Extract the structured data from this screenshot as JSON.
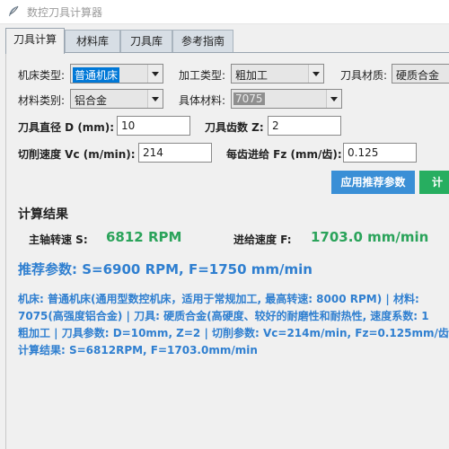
{
  "window": {
    "title": "数控刀具计算器"
  },
  "tabs": [
    {
      "label": "刀具计算",
      "active": true
    },
    {
      "label": "材料库",
      "active": false
    },
    {
      "label": "刀具库",
      "active": false
    },
    {
      "label": "参考指南",
      "active": false
    }
  ],
  "form": {
    "machine_type_label": "机床类型:",
    "machine_type_value": "普通机床",
    "process_type_label": "加工类型:",
    "process_type_value": "粗加工",
    "tool_material_label": "刀具材质:",
    "tool_material_value": "硬质合金",
    "material_category_label": "材料类别:",
    "material_category_value": "铝合金",
    "specific_material_label": "具体材料:",
    "specific_material_value": "7075",
    "tool_diameter_label": "刀具直径 D (mm):",
    "tool_diameter_value": "10",
    "teeth_label": "刀具齿数 Z:",
    "teeth_value": "2",
    "cutting_speed_label": "切削速度 Vc (m/min):",
    "cutting_speed_value": "214",
    "feed_per_tooth_label": "每齿进给 Fz (mm/齿):",
    "feed_per_tooth_value": "0.125"
  },
  "buttons": {
    "apply_recommended": "应用推荐参数",
    "calculate": "计算"
  },
  "results": {
    "heading": "计算结果",
    "spindle_label": "主轴转速 S:",
    "spindle_value": "6812 RPM",
    "feed_label": "进给速度 F:",
    "feed_value": "1703.0 mm/min",
    "recommended": "推荐参数: S=6900 RPM, F=1750 mm/min",
    "info_lines": [
      "机床: 普通机床(通用型数控机床，适用于常规加工, 最高转速: 8000 RPM) | 材料:",
      "7075(高强度铝合金) | 刀具: 硬质合金(高硬度、较好的耐磨性和耐热性, 速度系数: 1",
      "粗加工 | 刀具参数: D=10mm, Z=2 | 切削参数: Vc=214m/min, Fz=0.125mm/齿",
      "计算结果: S=6812RPM, F=1703.0mm/min"
    ]
  },
  "colors": {
    "accent_blue": "#3a8fd6",
    "accent_green": "#2aa35a",
    "result_green": "#2aa35a",
    "info_blue": "#2f7fd0"
  },
  "icons": {
    "app": "feather-icon"
  }
}
